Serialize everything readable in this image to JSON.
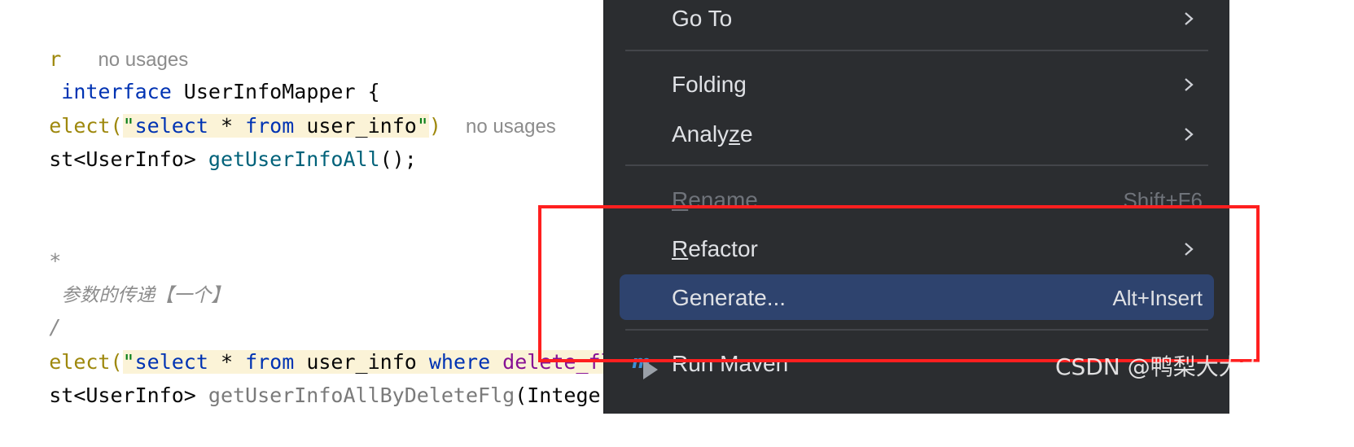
{
  "editor": {
    "line1": {
      "prefix": "r",
      "hint": "no usages"
    },
    "line2": {
      "kw": "interface",
      "name": " UserInfoMapper {"
    },
    "line3": {
      "ann": "elect(",
      "q_open": "\"",
      "sql_select": "select",
      "sql_mid": " * ",
      "sql_from": "from",
      "sql_table": " user_info",
      "q_close": "\"",
      "ann_close": ")",
      "hint": "no usages"
    },
    "line4": {
      "type": "st<UserInfo> ",
      "method": "getUserInfoAll",
      "rest": "();"
    },
    "line6": {
      "text": "*"
    },
    "line7": {
      "text": "参数的传递【一个】"
    },
    "line8": {
      "text": "/"
    },
    "line9": {
      "ann": "elect(",
      "q_open": "\"",
      "sql_select": "select",
      "sql_mid": " * ",
      "sql_from": "from",
      "sql_table": " user_info ",
      "sql_where": "where",
      "sql_col": " delete_flag"
    },
    "line10": {
      "type": "st<UserInfo> ",
      "method": "getUserInfoAllByDeleteFlg",
      "rest": "(Integer fl"
    }
  },
  "menu": {
    "items": [
      {
        "label": "Go To",
        "submenu": true
      },
      {
        "label": "Folding",
        "submenu": true
      },
      {
        "label_pre": "Analy",
        "label_mn": "z",
        "label_post": "e",
        "submenu": true
      },
      {
        "label_mn": "R",
        "label_post": "ename",
        "shortcut": "Shift+F6",
        "disabled": true
      },
      {
        "label_mn": "R",
        "label_post": "efactor",
        "submenu": true
      },
      {
        "label": "Generate...",
        "shortcut": "Alt+Insert",
        "selected": true
      },
      {
        "label": "Run Maven",
        "icon": "maven-icon",
        "submenu": true
      }
    ]
  },
  "watermark": "CSDN @鸭梨大大大",
  "colors": {
    "menu_bg": "#2b2d30",
    "selection": "#2e436e",
    "highlight_box": "#ff1f1f",
    "editor_bg": "#ffffff"
  }
}
